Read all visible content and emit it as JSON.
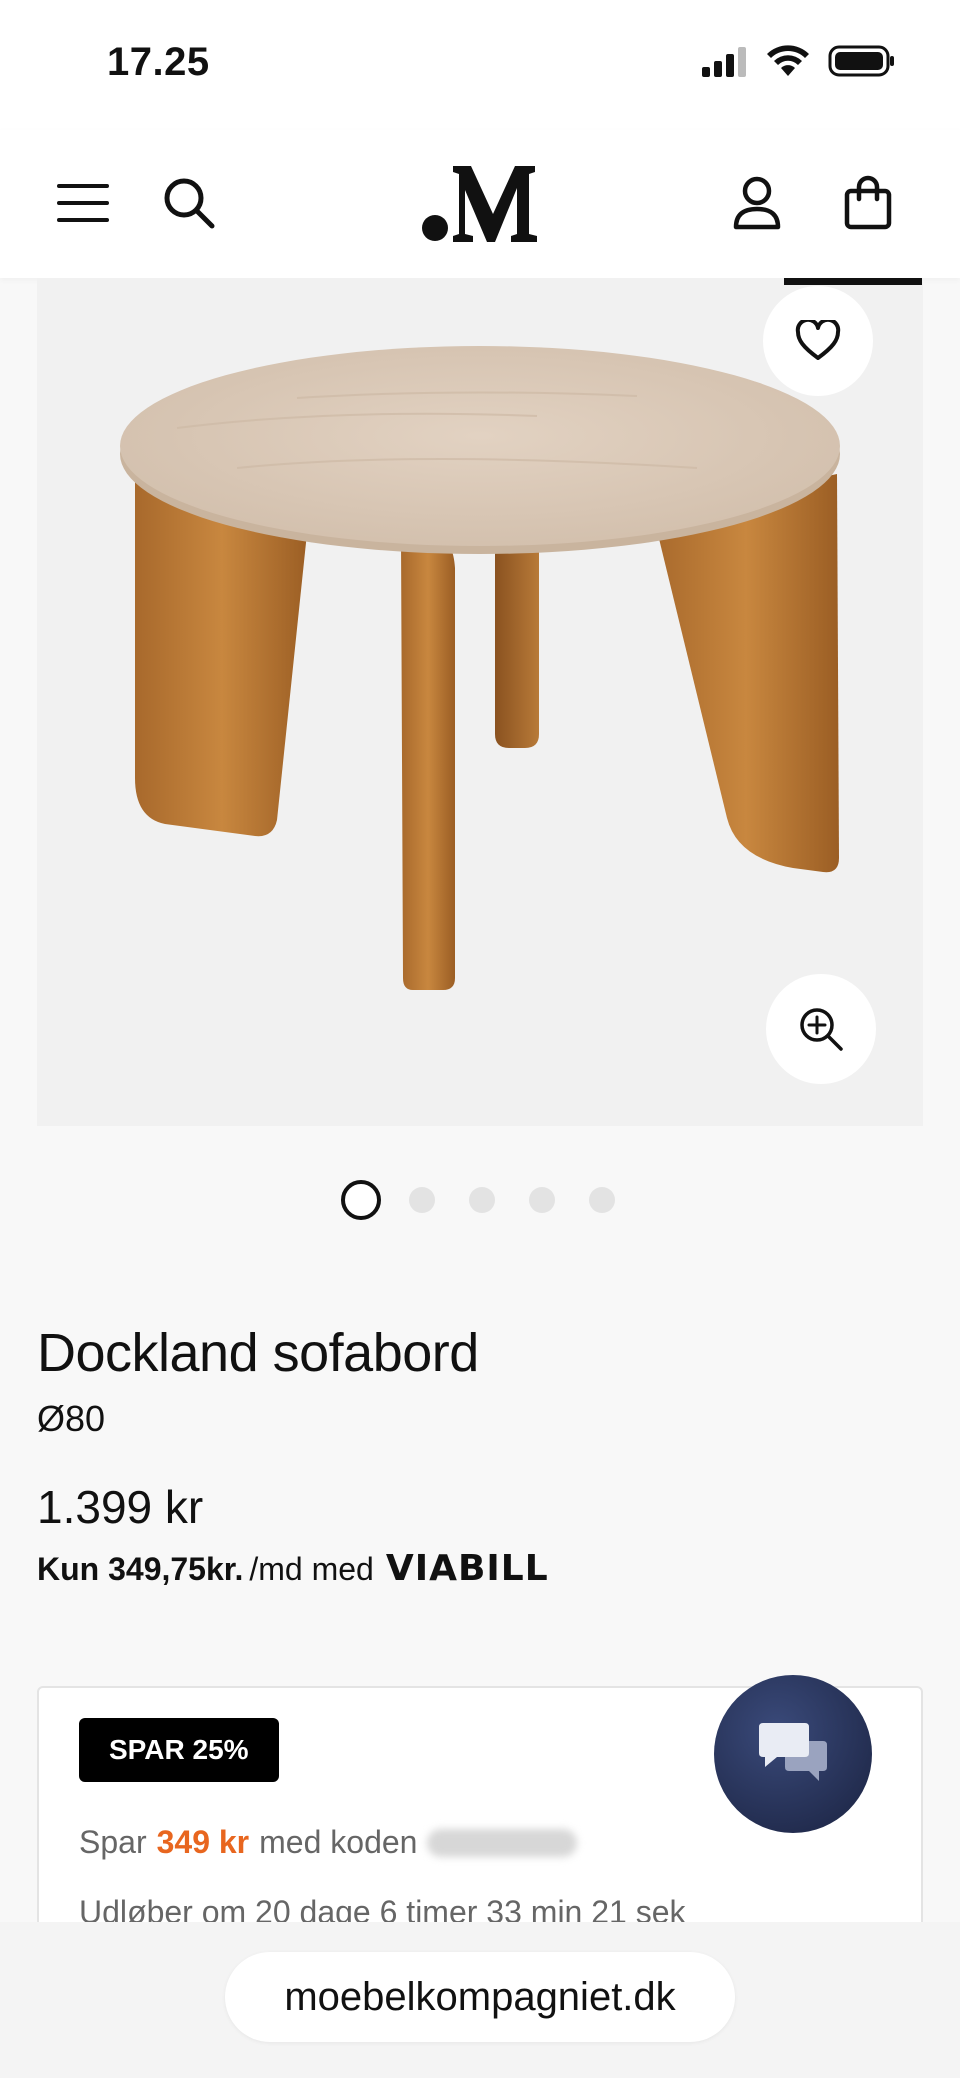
{
  "status": {
    "time": "17.25"
  },
  "header": {
    "logo": ".M"
  },
  "gallery": {
    "slide_count": 5,
    "active_slide": 1
  },
  "product": {
    "title": "Dockland sofabord",
    "variant": "Ø80",
    "price": "1.399 kr",
    "installment_amount": "Kun 349,75kr.",
    "installment_text": "/md med",
    "installment_brand": "VIABILL"
  },
  "promo": {
    "badge": "SPAR 25%",
    "prefix": "Spar",
    "amount": "349 kr",
    "suffix": "med koden",
    "expires": "Udløber om 20 dage 6 timer 33 min 21 sek"
  },
  "browser": {
    "url": "moebelkompagniet.dk"
  },
  "colors": {
    "accent": "#e8661f",
    "chat": "#1a2240"
  }
}
